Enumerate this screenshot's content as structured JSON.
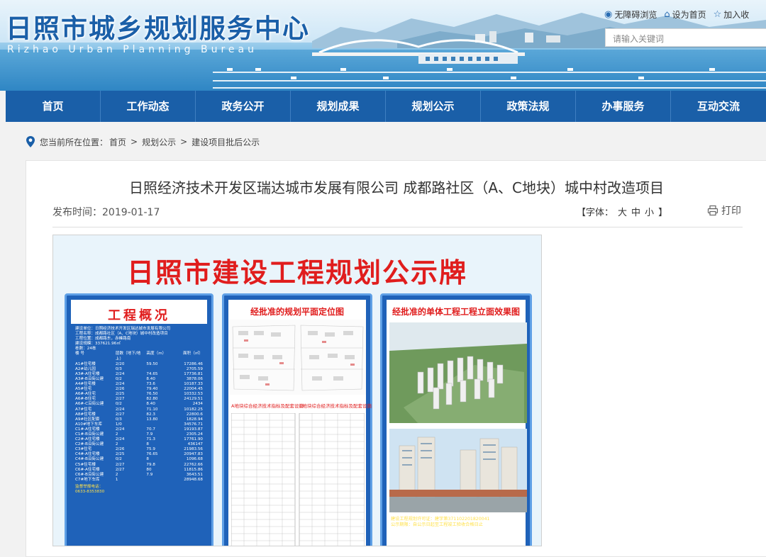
{
  "header": {
    "title": "日照市城乡规划服务中心",
    "subtitle": "Rizhao Urban Planning Bureau",
    "top_links": [
      {
        "label": "无障碍浏览",
        "icon": "eye-icon"
      },
      {
        "label": "设为首页",
        "icon": "home-icon"
      },
      {
        "label": "加入收",
        "icon": "star-icon"
      }
    ],
    "search_placeholder": "请输入关键词"
  },
  "nav": {
    "items": [
      "首页",
      "工作动态",
      "政务公开",
      "规划成果",
      "规划公示",
      "政策法规",
      "办事服务",
      "互动交流"
    ]
  },
  "breadcrumb": {
    "prefix": "您当前所在位置：",
    "items": [
      "首页",
      "规划公示",
      "建设项目批后公示"
    ],
    "separators": [
      ">",
      ">"
    ]
  },
  "article": {
    "title": "日照经济技术开发区瑞达城市发展有限公司 成都路社区（A、C地块）城中村改造项目",
    "publish_label": "发布时间：",
    "publish_date": "2019-01-17",
    "font_label_open": "【字体：",
    "font_options": [
      "大",
      "中",
      "小"
    ],
    "font_label_close": "】",
    "print_label": "打印"
  },
  "billboard": {
    "title": "日照市建设工程规划公示牌",
    "box1_title": "工程概况",
    "box1_info": [
      "建设单位：日照经济技术开发区瑞达城市发展有限公司",
      "工程名称：成都路社区（A、C地块）城中村改造项目",
      "工程位置：成都路东，赤峰路南",
      "建设规模：337621.96㎡",
      "栋数：24栋"
    ],
    "box1_header": [
      "楼 号",
      "层数（地下/地上）",
      "高度（m）",
      "面积（㎡）"
    ],
    "box1_rows": [
      [
        "A1#住宅楼",
        "2/20",
        "59.50",
        "17286.46"
      ],
      [
        "A2#幼儿园",
        "0/3",
        "",
        "2705.59"
      ],
      [
        "A3#-A住宅楼",
        "2/24",
        "74.65",
        "17736.81"
      ],
      [
        "A3#-B沿街公建",
        "0/2",
        "8.40",
        "3878.06"
      ],
      [
        "A4#住宅楼",
        "2/24",
        "73.6",
        "10187.33"
      ],
      [
        "A5#住宅",
        "2/26",
        "79.40",
        "22004.45"
      ],
      [
        "A6#-A住宅",
        "2/25",
        "76.50",
        "10332.53"
      ],
      [
        "A6#-B住宅",
        "2/27",
        "82.80",
        "24129.51"
      ],
      [
        "A6#-C沿街公建",
        "0/2",
        "8.40",
        "2434"
      ],
      [
        "A7#住宅",
        "2/24",
        "71.10",
        "10182.25"
      ],
      [
        "A8#住宅楼",
        "2/27",
        "82.3",
        "22800.6"
      ],
      [
        "A9#社区配套",
        "0/3",
        "13.80",
        "1828.94"
      ],
      [
        "A10#地下车库",
        "1/0",
        "",
        "34576.71"
      ],
      [
        "C1#-A住宅楼",
        "2/24",
        "70.7",
        "19193.87"
      ],
      [
        "C1#-B沿街公建",
        "2",
        "7.9",
        "2305.24"
      ],
      [
        "C2#-A住宅楼",
        "2/24",
        "71.3",
        "17761.90"
      ],
      [
        "C2#-B沿街公建",
        "2",
        "8",
        "436147"
      ],
      [
        "C3#住宅",
        "2/26",
        "75.9",
        "21983.56"
      ],
      [
        "C4#-A住宅楼",
        "2/25",
        "76.65",
        "20947.83"
      ],
      [
        "C4#-B沿街公建",
        "0/2",
        "8",
        "1096.68"
      ],
      [
        "C5#住宅楼",
        "2/27",
        "79.8",
        "22762.66"
      ],
      [
        "C6#-A住宅楼",
        "2/27",
        "80",
        "11815.86"
      ],
      [
        "C6#-B沿街公建",
        "2",
        "7.9",
        "3643.51"
      ],
      [
        "C7#地下车库",
        "1",
        "",
        "28948.68"
      ]
    ],
    "box1_footer": [
      "监督举报电话：",
      "0633-8353830"
    ],
    "box2_title": "经批准的规划平面定位图",
    "box2_labels": [
      "A地块综合经济技术指标及配套设施",
      "C地块综合经济技术指标及配套设施"
    ],
    "box3_title": "经批准的单体工程工程立面效果图",
    "box3_footer": [
      "建设工程规划许可证：建字第371102201820041",
      "公示期限：自公示日起至工程竣工验收合格日止"
    ]
  }
}
